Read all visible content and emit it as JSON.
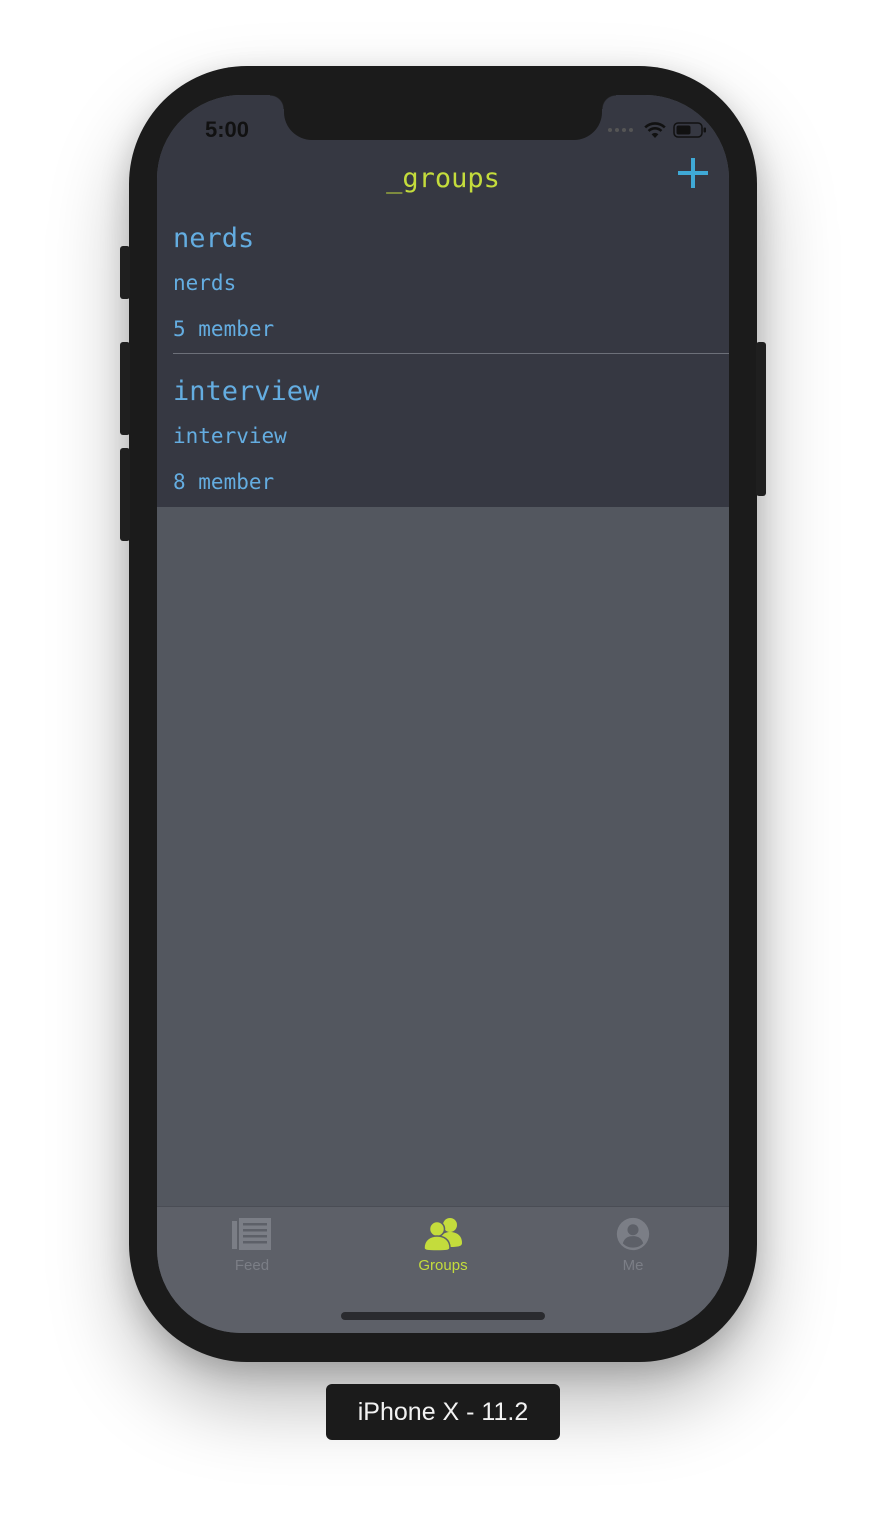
{
  "status_bar": {
    "time": "5:00",
    "wifi_icon": "wifi-icon",
    "battery_icon": "battery-icon"
  },
  "nav": {
    "title": "_groups",
    "add_icon": "plus-icon"
  },
  "groups": [
    {
      "name": "nerds",
      "description": "nerds",
      "members": "5 member"
    },
    {
      "name": "interview",
      "description": "interview",
      "members": "8 member"
    }
  ],
  "tabs": [
    {
      "label": "Feed",
      "icon": "feed-icon",
      "active": false
    },
    {
      "label": "Groups",
      "icon": "groups-icon",
      "active": true
    },
    {
      "label": "Me",
      "icon": "profile-icon",
      "active": false
    }
  ],
  "device_label": "iPhone X - 11.2",
  "colors": {
    "accent": "#c4dc3c",
    "link": "#64ade1",
    "add_button": "#3fa9d6",
    "header_bg": "#363842",
    "content_bg": "#53575f",
    "tab_bar_bg": "#5d6068"
  }
}
